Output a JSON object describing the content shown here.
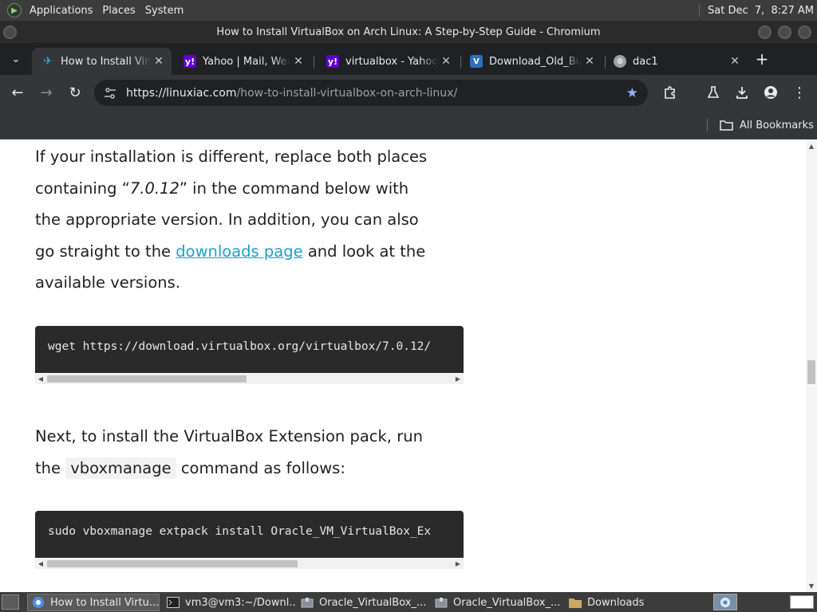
{
  "top_panel": {
    "menus": [
      "Applications",
      "Places",
      "System"
    ],
    "clock": "Sat Dec  7,  8:27 AM"
  },
  "window": {
    "title": "How to Install VirtualBox on Arch Linux: A Step-by-Step Guide - Chromium"
  },
  "tabs": [
    {
      "label": "How to Install VirtualBox on Arch Linux",
      "favicon": "linuxiac-icon",
      "color": "#3ba3d8"
    },
    {
      "label": "Yahoo | Mail, Weather",
      "favicon": "yahoo-icon",
      "color": "#6001d2"
    },
    {
      "label": "virtualbox - Yahoo Search",
      "favicon": "yahoo-icon",
      "color": "#6001d2"
    },
    {
      "label": "Download_Old_Builds",
      "favicon": "virtualbox-icon",
      "color": "#2f6fb8"
    },
    {
      "label": "dac1",
      "favicon": "globe-icon",
      "color": "#9aa0a6"
    }
  ],
  "toolbar": {
    "url_host": "https://linuxiac.com",
    "url_path": "/how-to-install-virtualbox-on-arch-linux/"
  },
  "bookmarks": {
    "all_bookmarks": "All Bookmarks"
  },
  "article": {
    "p1_a": "If your installation is different, replace both places containing “",
    "p1_version": "7.0.12",
    "p1_b": "” in the command below with the appropriate version. In addition, you can also go straight to the ",
    "p1_link": "downloads page",
    "p1_c": " and look at the available versions.",
    "code1": "wget https://download.virtualbox.org/virtualbox/7.0.12/",
    "p2_a": "Next, to install the VirtualBox Extension pack, run the ",
    "p2_code": "vboxmanage",
    "p2_b": " command as follows:",
    "code2": "sudo vboxmanage extpack install Oracle_VM_VirtualBox_Ex"
  },
  "taskbar": {
    "items": [
      {
        "label": "How to Install Virtu...",
        "icon": "chromium-icon"
      },
      {
        "label": "vm3@vm3:~/Downl...",
        "icon": "terminal-icon"
      },
      {
        "label": "Oracle_VirtualBox_...",
        "icon": "archive-icon"
      },
      {
        "label": "Oracle_VirtualBox_...",
        "icon": "archive-icon"
      },
      {
        "label": "Downloads",
        "icon": "folder-icon"
      }
    ]
  }
}
